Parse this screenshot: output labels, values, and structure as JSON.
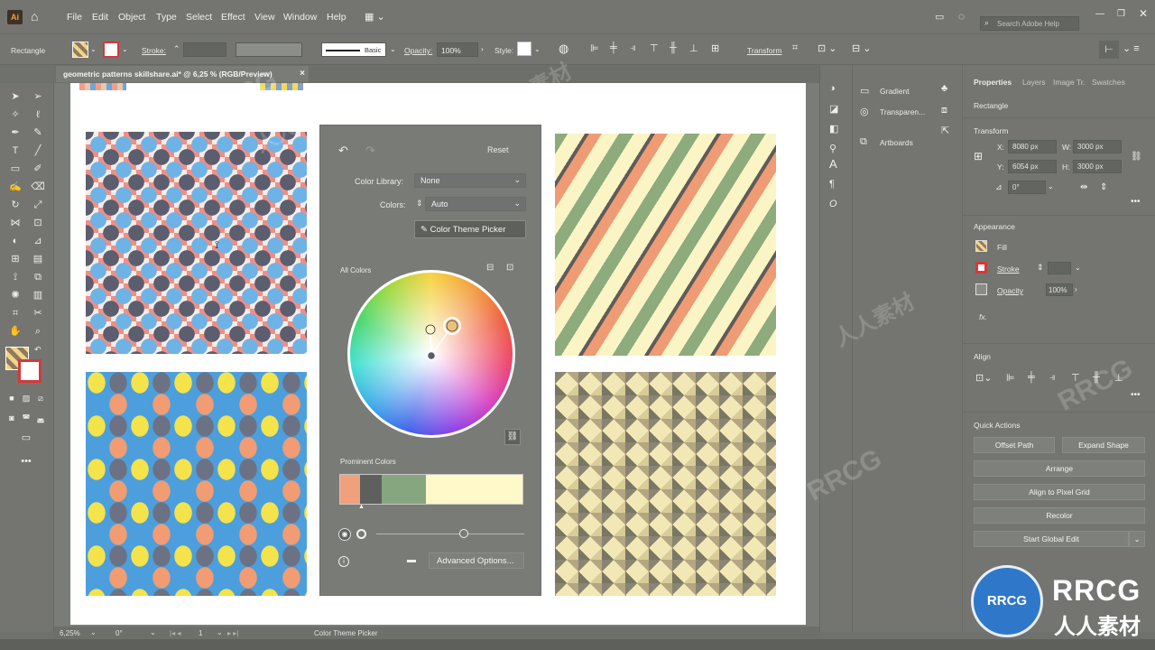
{
  "app": {
    "logo": "Ai",
    "search_placeholder": "Search Adobe Help"
  },
  "menu": [
    "File",
    "Edit",
    "Object",
    "Type",
    "Select",
    "Effect",
    "View",
    "Window",
    "Help"
  ],
  "control": {
    "selection": "Rectangle",
    "stroke_label": "Stroke:",
    "brush": "Basic",
    "opacity_label": "Opacity:",
    "opacity": "100%",
    "style_label": "Style:",
    "transform": "Transform"
  },
  "document": {
    "tab_title": "geometric patterns skillshare.ai* @ 6,25 % (RGB/Preview)",
    "close": "×"
  },
  "recolor": {
    "reset": "Reset",
    "library_label": "Color Library:",
    "library_value": "None",
    "colors_label": "Colors:",
    "colors_value": "Auto",
    "theme_picker": "Color Theme Picker",
    "all_colors": "All Colors",
    "prominent": "Prominent Colors",
    "advanced": "Advanced Options...",
    "swatches": [
      "#f0a07c",
      "#5f5f5d",
      "#86a680",
      "#fff8c8"
    ],
    "swatch_fractions": [
      0.11,
      0.12,
      0.24,
      0.53
    ]
  },
  "status": {
    "zoom": "6,25%",
    "rotation": "0°",
    "page": "1",
    "tool": "Color Theme Picker"
  },
  "libraries": [
    "Gradient",
    "Transparen...",
    "Artboards"
  ],
  "properties": {
    "tabs": [
      "Properties",
      "Layers",
      "Image Tr.",
      "Swatches"
    ],
    "object": "Rectangle",
    "transform_title": "Transform",
    "x_label": "X:",
    "x": "8080 px",
    "y_label": "Y:",
    "y": "6054 px",
    "w_label": "W:",
    "w": "3000 px",
    "h_label": "H:",
    "h": "3000 px",
    "angle": "0°",
    "appearance_title": "Appearance",
    "fill": "Fill",
    "stroke": "Stroke",
    "opacity": "Opacity",
    "opacity_value": "100%",
    "fx": "fx.",
    "align_title": "Align",
    "quick_actions_title": "Quick Actions",
    "offset_path": "Offset Path",
    "expand_shape": "Expand Shape",
    "arrange": "Arrange",
    "align_pixel": "Align to Pixel Grid",
    "recolor": "Recolor",
    "global_edit": "Start Global Edit"
  },
  "watermark": {
    "brand": "RRCG",
    "sub": "人人素材",
    "mark": "RRCG"
  }
}
